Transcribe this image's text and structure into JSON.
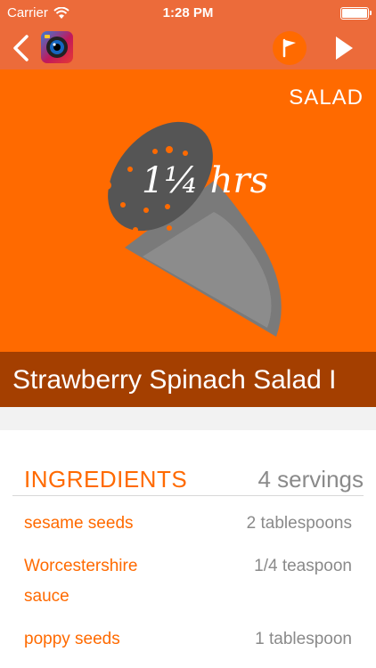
{
  "status_bar": {
    "carrier": "Carrier",
    "time": "1:28 PM",
    "icons": [
      "wifi-icon",
      "battery-icon"
    ]
  },
  "nav": {
    "back_icon": "chevron-left-icon",
    "app_icon": "camera-lens-app-icon",
    "flag_icon": "flag-icon",
    "play_icon": "play-icon"
  },
  "hero": {
    "category": "SALAD",
    "duration": "1¼ hrs",
    "art_icon": "timer-egg-icon"
  },
  "recipe": {
    "title": "Strawberry Spinach Salad I"
  },
  "ingredients": {
    "heading": "INGREDIENTS",
    "servings": "4 servings",
    "items": [
      {
        "name": "sesame seeds",
        "quantity": "2 tablespoons"
      },
      {
        "name": "Worcestershire sauce",
        "quantity": "1/4 teaspoon"
      },
      {
        "name": "poppy seeds",
        "quantity": "1 tablespoon"
      }
    ]
  },
  "colors": {
    "nav": "#ec6b3a",
    "hero": "#ff6a00",
    "title_band": "#a43f00",
    "accent": "#ff6a00",
    "muted_text": "#8a8a8a"
  }
}
